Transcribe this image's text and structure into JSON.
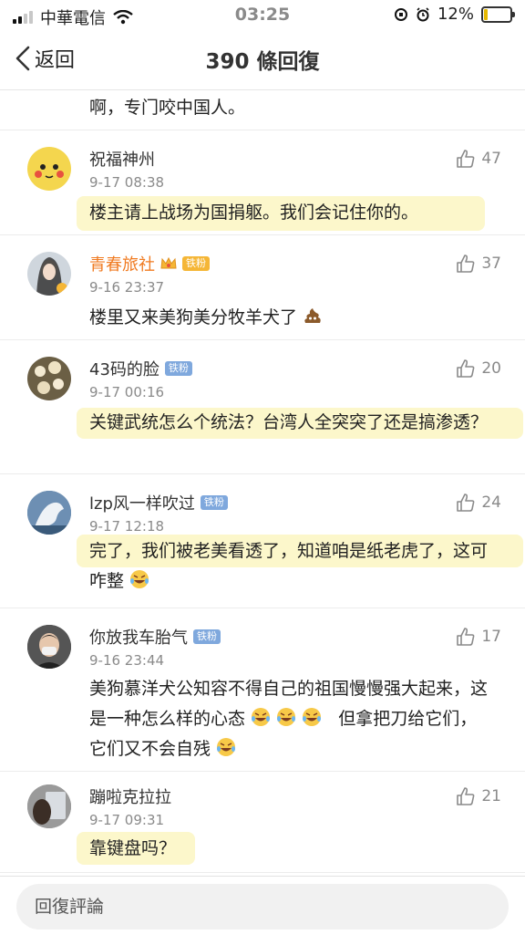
{
  "status_bar": {
    "carrier": "中華電信",
    "time": "03:25",
    "battery": "12%"
  },
  "nav": {
    "back_label": "返回",
    "title": "390 條回復"
  },
  "partial_comment": {
    "text": "啊，专门咬中国人。"
  },
  "comments": [
    {
      "name": "祝福神州",
      "badge": "",
      "time": "9-17 08:38",
      "likes": "47",
      "text": "楼主请上战场为国捐躯。我们会记住你的。",
      "emoji": ""
    },
    {
      "name": "青春旅社",
      "badge": "铁粉",
      "time": "9-16 23:37",
      "likes": "37",
      "text": "楼里又来美狗美分牧羊犬了",
      "emoji": "poop-emoji"
    },
    {
      "name": "43码的脸",
      "badge": "铁粉",
      "time": "9-17 00:16",
      "likes": "20",
      "text": "关键武统怎么个统法？台湾人全突突了还是搞渗透？",
      "emoji": ""
    },
    {
      "name": "lzp风一样吹过",
      "badge": "铁粉",
      "time": "9-17 12:18",
      "likes": "24",
      "text": "完了，我们被老美看透了，知道咱是纸老虎了，这可咋整",
      "emoji": "crying-laughing-emoji"
    },
    {
      "name": "你放我车胎气",
      "badge": "铁粉",
      "time": "9-16 23:44",
      "likes": "17",
      "text_a": "美狗慕洋犬公知容不得自己的祖国慢慢强大起来，这是一种怎么样的心态",
      "text_b": "但拿把刀给它们，它们又不会自残"
    },
    {
      "name": "蹦啦克拉拉",
      "badge": "",
      "time": "9-17 09:31",
      "likes": "21",
      "text": "靠键盘吗？",
      "emoji": ""
    }
  ],
  "input": {
    "placeholder": "回復評論"
  },
  "colors": {
    "accent_orange": "#f07a20",
    "highlight": "#faf0a0",
    "badge_blue": "#7fa8dd"
  }
}
